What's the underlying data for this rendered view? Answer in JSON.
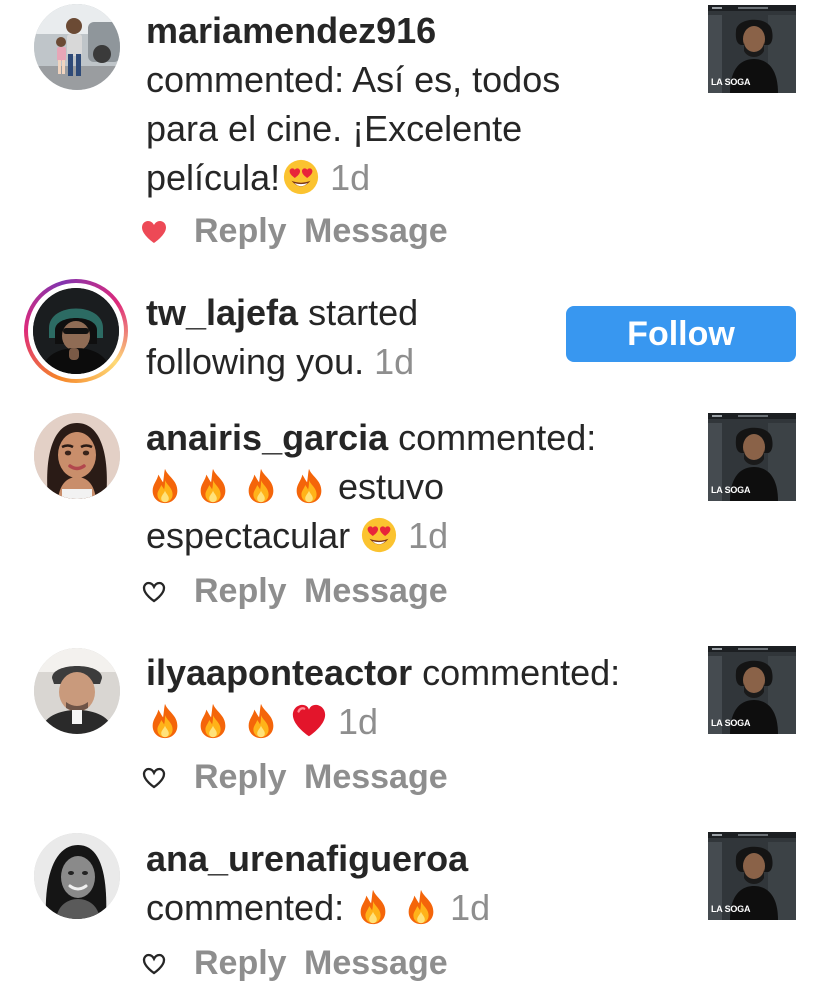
{
  "notifications": [
    {
      "username": "mariamendez916",
      "line1_rest": "",
      "line2": "commented: Así es, todos",
      "line3": "para el cine. ¡Excelente",
      "line4": "película!",
      "time": "1d",
      "liked": true,
      "reply_label": "Reply",
      "message_label": "Message",
      "thumb_label": "LA SOGA"
    },
    {
      "username": "tw_lajefa",
      "line1_rest": " started",
      "line2": "following you.",
      "time": "1d",
      "follow_label": "Follow"
    },
    {
      "username": "anairis_garcia",
      "line1_rest": " commented:",
      "line2": "estuvo",
      "line3": "espectacular",
      "time": "1d",
      "liked": false,
      "reply_label": "Reply",
      "message_label": "Message",
      "thumb_label": "LA SOGA"
    },
    {
      "username": "ilyaaponteactor",
      "line1_rest": " commented:",
      "time": "1d",
      "liked": false,
      "reply_label": "Reply",
      "message_label": "Message",
      "thumb_label": "LA SOGA"
    },
    {
      "username": "ana_urenafigueroa",
      "line2": "commented:",
      "time": "1d",
      "liked": false,
      "reply_label": "Reply",
      "message_label": "Message",
      "thumb_label": "LA SOGA"
    }
  ],
  "colors": {
    "follow_button": "#3897f0",
    "like_heart": "#ed4956",
    "muted_text": "#8e8e8e"
  },
  "icons": {
    "liked": "heart-filled-icon",
    "unliked": "heart-outline-icon",
    "fire": "fire-emoji",
    "heart_eyes": "heart-eyes-emoji",
    "red_heart": "red-heart-emoji"
  }
}
